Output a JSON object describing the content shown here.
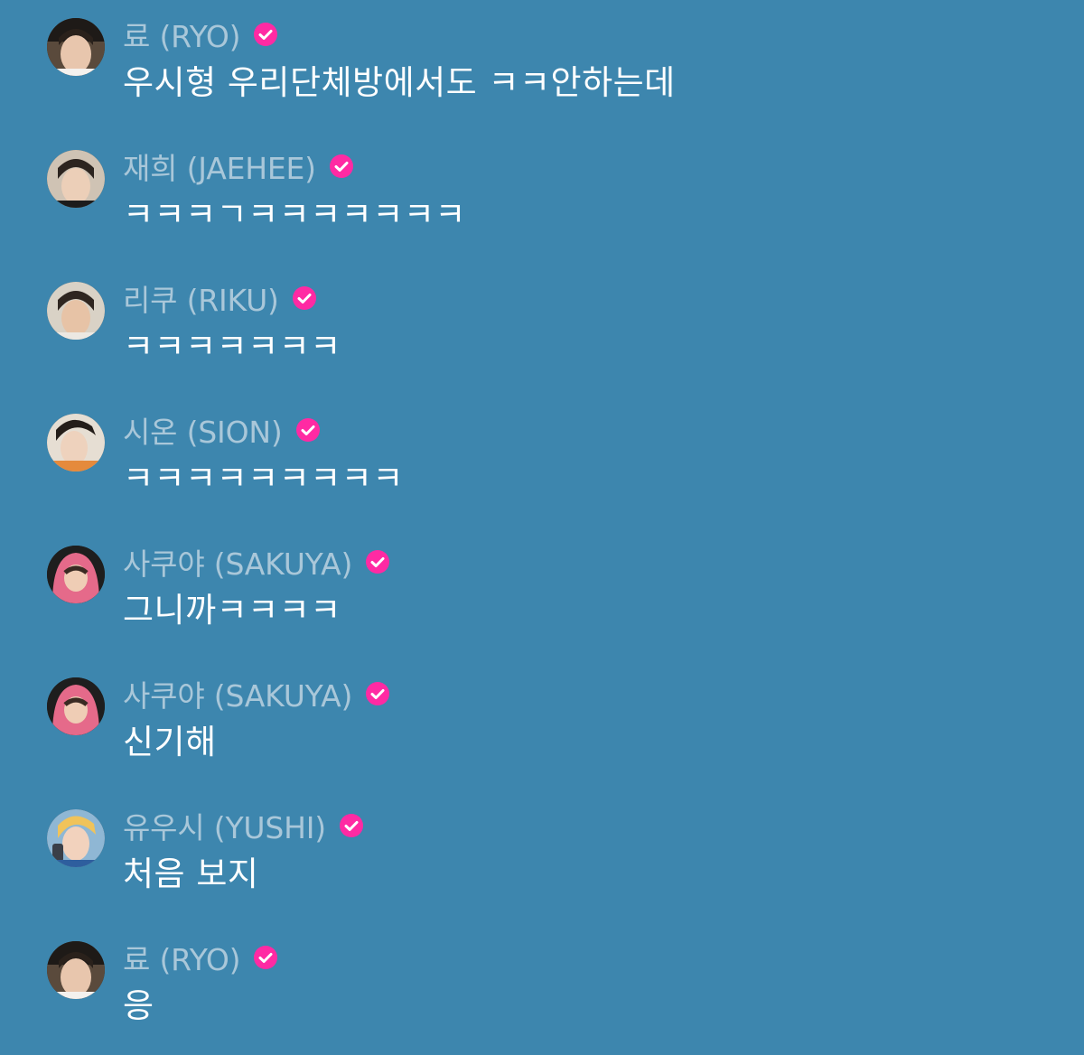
{
  "colors": {
    "background": "#3d86ae",
    "username": "#a9c7d9",
    "message_text": "#ffffff",
    "verified_badge": "#ff2aa3"
  },
  "messages": [
    {
      "username": "료 (RYO)",
      "text": "우시형 우리단체방에서도 ㅋㅋ안하는데",
      "avatar": "avatar-ryo",
      "verified_icon": "verified-check-icon"
    },
    {
      "username": "재희 (JAEHEE)",
      "text": "ㅋㅋㅋㄱㅋㅋㅋㅋㅋㅋㅋ",
      "avatar": "avatar-jaehee",
      "verified_icon": "verified-check-icon"
    },
    {
      "username": "리쿠 (RIKU)",
      "text": "ㅋㅋㅋㅋㅋㅋㅋ",
      "avatar": "avatar-riku",
      "verified_icon": "verified-check-icon"
    },
    {
      "username": "시온 (SION)",
      "text": "ㅋㅋㅋㅋㅋㅋㅋㅋㅋ",
      "avatar": "avatar-sion",
      "verified_icon": "verified-check-icon"
    },
    {
      "username": "사쿠야 (SAKUYA)",
      "text": "그니까ㅋㅋㅋㅋ",
      "avatar": "avatar-sakuya",
      "verified_icon": "verified-check-icon"
    },
    {
      "username": "사쿠야 (SAKUYA)",
      "text": "신기해",
      "avatar": "avatar-sakuya",
      "verified_icon": "verified-check-icon"
    },
    {
      "username": "유우시 (YUSHI)",
      "text": "처음 보지",
      "avatar": "avatar-yushi",
      "verified_icon": "verified-check-icon"
    },
    {
      "username": "료 (RYO)",
      "text": "응",
      "avatar": "avatar-ryo",
      "verified_icon": "verified-check-icon"
    }
  ]
}
